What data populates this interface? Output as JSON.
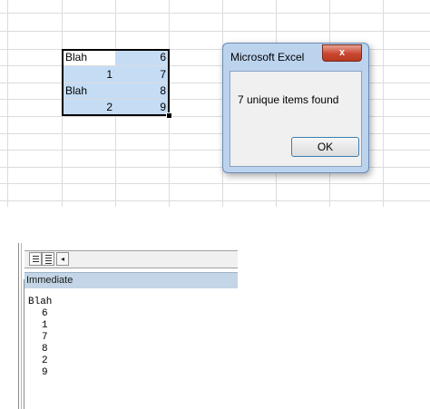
{
  "sheet": {
    "cells": [
      {
        "row": 0,
        "a": "Blah",
        "b": "6"
      },
      {
        "row": 1,
        "a": "1",
        "b": "7"
      },
      {
        "row": 2,
        "a": "Blah",
        "b": "8"
      },
      {
        "row": 3,
        "a": "2",
        "b": "9"
      }
    ]
  },
  "dialog": {
    "title": "Microsoft Excel",
    "close_glyph": "x",
    "message": "7 unique items found",
    "ok_label": "OK"
  },
  "vbe": {
    "scroll_left_glyph": "◂",
    "immediate": {
      "title": "Immediate",
      "lines": [
        "Blah",
        "6",
        "1",
        "7",
        "8",
        "2",
        "9"
      ]
    }
  }
}
